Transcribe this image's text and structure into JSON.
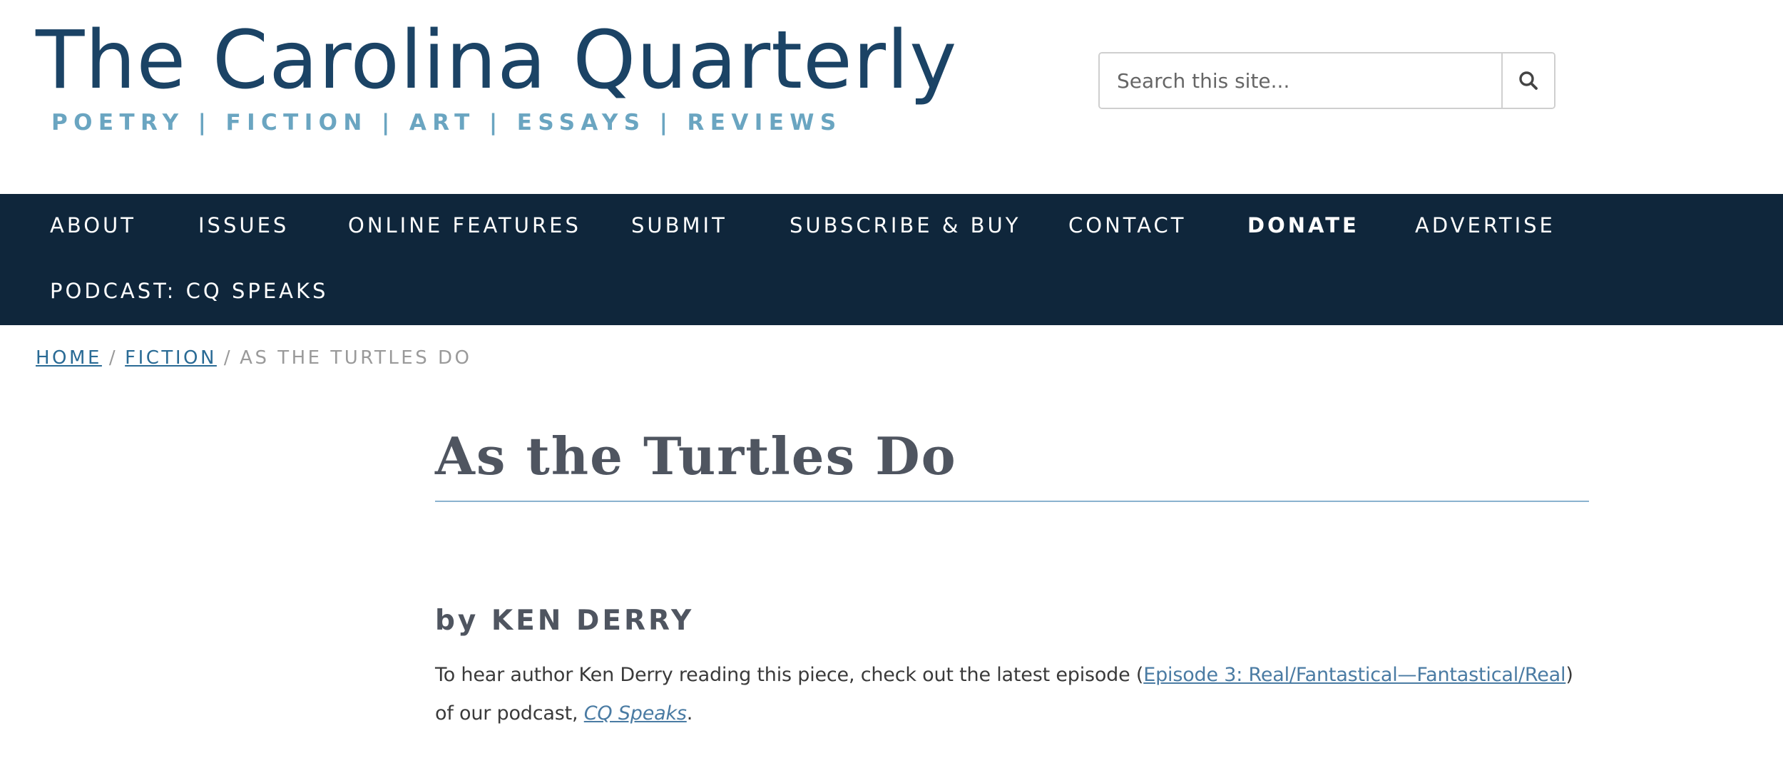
{
  "header": {
    "site_title": "The Carolina Quarterly",
    "tagline": "POETRY | FICTION | ART | ESSAYS | REVIEWS"
  },
  "search": {
    "placeholder": "Search this site...",
    "value": "",
    "button_icon": "search-icon"
  },
  "nav": {
    "items": [
      {
        "label": "ABOUT"
      },
      {
        "label": "ISSUES"
      },
      {
        "label": "ONLINE FEATURES"
      },
      {
        "label": "SUBMIT"
      },
      {
        "label": "SUBSCRIBE & BUY"
      },
      {
        "label": "CONTACT"
      },
      {
        "label": "DONATE"
      },
      {
        "label": "ADVERTISE"
      },
      {
        "label": "PODCAST: CQ SPEAKS"
      }
    ]
  },
  "breadcrumb": {
    "home": "HOME",
    "section": "FICTION",
    "current": "AS THE TURTLES DO",
    "separator": "/"
  },
  "article": {
    "title": "As the Turtles Do",
    "byline": "by KEN DERRY",
    "intro_before": "To hear author Ken Derry reading this piece, check out the latest episode (",
    "episode_link": "Episode 3: Real/Fantastical—Fantastical/Real",
    "intro_middle": ") of our podcast, ",
    "podcast_link": "CQ Speaks",
    "intro_end": "."
  },
  "colors": {
    "brand_navy": "#1b4365",
    "tagline_blue": "#6aa5c1",
    "nav_background": "#0f263b",
    "link_blue": "#2a6b95",
    "title_gray": "#4f5560"
  }
}
